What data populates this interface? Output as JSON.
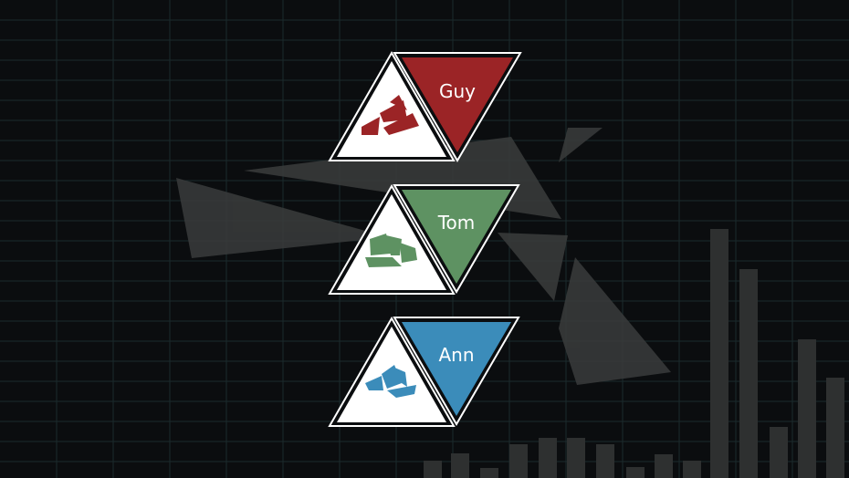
{
  "screen": "player-select",
  "players": [
    {
      "name": "Guy",
      "color": "#9b2426",
      "icon": "red-rubble-icon"
    },
    {
      "name": "Tom",
      "color": "#5e9262",
      "icon": "green-blocks-icon"
    },
    {
      "name": "Ann",
      "color": "#3b8cba",
      "icon": "blue-crystal-icon"
    }
  ],
  "theme": {
    "background": "#0b0d0f",
    "grid": "#1b2a2c",
    "shards": "#3a3c3c",
    "bars": "#2e3030"
  }
}
